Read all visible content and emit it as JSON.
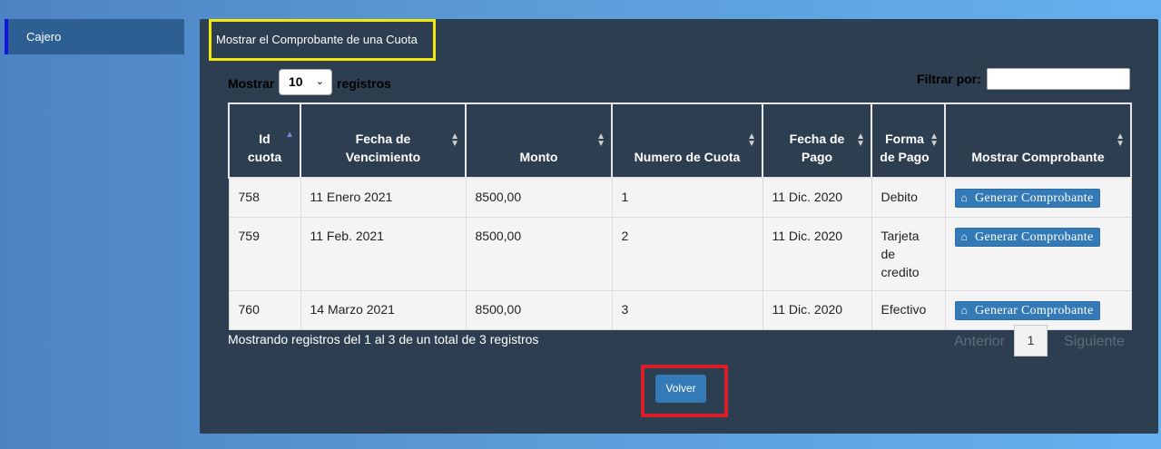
{
  "sidebar": {
    "items": [
      {
        "label": "Cajero"
      }
    ]
  },
  "panel": {
    "title": "Mostrar el Comprobante de una Cuota",
    "length_prefix": "Mostrar",
    "length_value": "10",
    "length_suffix": "registros",
    "filter_label": "Filtrar por:",
    "filter_value": ""
  },
  "table": {
    "columns": [
      {
        "label": "Id cuota",
        "sort": "asc"
      },
      {
        "label": "Fecha de Vencimiento",
        "sort": "both"
      },
      {
        "label": "Monto",
        "sort": "both"
      },
      {
        "label": "Numero de Cuota",
        "sort": "both"
      },
      {
        "label": "Fecha de Pago",
        "sort": "both"
      },
      {
        "label": "Forma de Pago",
        "sort": "both"
      },
      {
        "label": "Mostrar Comprobante",
        "sort": "both"
      }
    ],
    "rows": [
      {
        "id": "758",
        "vencimiento": "11 Enero 2021",
        "monto": "8500,00",
        "numero": "1",
        "pago": "11 Dic. 2020",
        "forma": "Debito",
        "action": "Generar Comprobante"
      },
      {
        "id": "759",
        "vencimiento": "11 Feb. 2021",
        "monto": "8500,00",
        "numero": "2",
        "pago": "11 Dic. 2020",
        "forma": "Tarjeta de credito",
        "action": "Generar Comprobante"
      },
      {
        "id": "760",
        "vencimiento": "14 Marzo 2021",
        "monto": "8500,00",
        "numero": "3",
        "pago": "11 Dic. 2020",
        "forma": "Efectivo",
        "action": "Generar Comprobante"
      }
    ]
  },
  "footer": {
    "info": "Mostrando registros del 1 al 3 de un total de 3 registros",
    "prev": "Anterior",
    "page": "1",
    "next": "Siguiente"
  },
  "volver_label": "Volver",
  "icons": {
    "home": "home-icon",
    "sort_asc": "sort-asc-icon",
    "sort_both": "sort-both-icon",
    "chevron": "chevron-down-icon"
  },
  "colors": {
    "panel": "#2c3e50",
    "button": "#337ab7",
    "highlight_yellow": "#f4e70b",
    "highlight_red": "#d81e27"
  }
}
